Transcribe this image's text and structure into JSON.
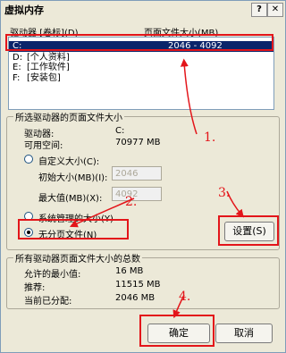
{
  "window": {
    "title": "虚拟内存",
    "help_label": "?",
    "close_label": "✕"
  },
  "list": {
    "col_drive": "驱动器 [卷标](D)",
    "col_pagefile": "页面文件大小(MB)",
    "rows": [
      {
        "drive": "C:",
        "label": "",
        "size": "2046 - 4092"
      },
      {
        "drive": "D:",
        "label": "[个人资料]",
        "size": ""
      },
      {
        "drive": "E:",
        "label": "[工作软件]",
        "size": ""
      },
      {
        "drive": "F:",
        "label": "[安装包]",
        "size": ""
      }
    ]
  },
  "selected": {
    "group_title": "所选驱动器的页面文件大小",
    "drive_label": "驱动器:",
    "drive_value": "C:",
    "space_label": "可用空间:",
    "space_value": "70977 MB",
    "custom_label": "自定义大小(C):",
    "initial_label": "初始大小(MB)(I):",
    "initial_value": "2046",
    "max_label": "最大值(MB)(X):",
    "max_value": "4092",
    "system_label": "系统管理的大小(Y)",
    "none_label": "无分页文件(N)",
    "set_button": "设置(S)"
  },
  "totals": {
    "group_title": "所有驱动器页面文件大小的总数",
    "min_label": "允许的最小值:",
    "min_value": "16 MB",
    "rec_label": "推荐:",
    "rec_value": "11515 MB",
    "cur_label": "当前已分配:",
    "cur_value": "2046 MB"
  },
  "footer": {
    "ok": "确定",
    "cancel": "取消"
  },
  "annotations": [
    "1.",
    "2.",
    "3.",
    "4."
  ],
  "colors": {
    "annotation": "#e3151a",
    "selection": "#0a246a"
  }
}
